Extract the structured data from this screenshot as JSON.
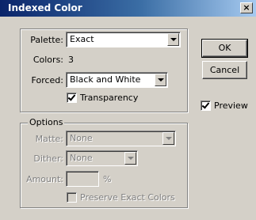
{
  "window": {
    "title": "Indexed Color",
    "close_label": "×"
  },
  "palette": {
    "label": "Palette:",
    "value": "Exact"
  },
  "colors": {
    "label": "Colors:",
    "value": "3"
  },
  "forced": {
    "label": "Forced:",
    "value": "Black and White"
  },
  "transparency": {
    "label": "Transparency",
    "checked": true
  },
  "buttons": {
    "ok": "OK",
    "cancel": "Cancel"
  },
  "preview": {
    "label": "Preview",
    "checked": true
  },
  "options": {
    "legend": "Options",
    "matte": {
      "label": "Matte:",
      "value": "None"
    },
    "dither": {
      "label": "Dither:",
      "value": "None"
    },
    "amount": {
      "label": "Amount:",
      "value": "",
      "unit": "%"
    },
    "preserve_exact": {
      "label": "Preserve Exact Colors",
      "checked": false
    }
  }
}
